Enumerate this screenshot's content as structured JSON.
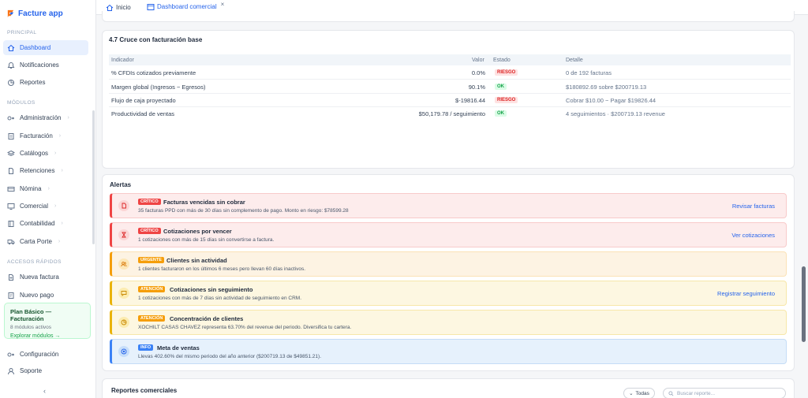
{
  "app": {
    "name": "Facture app"
  },
  "sidebar": {
    "sections": {
      "principal": "PRINCIPAL",
      "modulos": "MÓDULOS",
      "accesos": "ACCESOS RÁPIDOS"
    },
    "items": [
      {
        "label": "Dashboard",
        "icon": "home-icon"
      },
      {
        "label": "Notificaciones",
        "icon": "bell-icon"
      },
      {
        "label": "Reportes",
        "icon": "chart-icon"
      },
      {
        "label": "Administración",
        "icon": "gears-icon"
      },
      {
        "label": "Facturación",
        "icon": "receipt-icon"
      },
      {
        "label": "Catálogos",
        "icon": "layers-icon"
      },
      {
        "label": "Retenciones",
        "icon": "document-icon"
      },
      {
        "label": "Nómina",
        "icon": "card-icon"
      },
      {
        "label": "Comercial",
        "icon": "monitor-icon"
      },
      {
        "label": "Contabilidad",
        "icon": "book-icon"
      },
      {
        "label": "Carta Porte",
        "icon": "truck-icon"
      },
      {
        "label": "Nueva factura",
        "icon": "file-plus-icon"
      },
      {
        "label": "Nuevo pago",
        "icon": "payment-icon"
      },
      {
        "label": "Configuración",
        "icon": "settings-icon"
      },
      {
        "label": "Soporte",
        "icon": "support-icon"
      }
    ],
    "plan": {
      "title": "Plan Básico — Facturación",
      "subtitle": "8 módulos activos",
      "link": "Explorar módulos →"
    },
    "collapse": "‹"
  },
  "tabs": [
    {
      "label": "Inicio"
    },
    {
      "label": "Dashboard comercial",
      "close": "×"
    }
  ],
  "cruce": {
    "title": "4.7 Cruce con facturación base",
    "headers": {
      "indicador": "Indicador",
      "valor": "Valor",
      "estado": "Estado",
      "detalle": "Detalle"
    },
    "rows": [
      {
        "indicador": "% CFDIs cotizados previamente",
        "valor": "0.0%",
        "estado": "RIESGO",
        "detalle": "0 de 192 facturas"
      },
      {
        "indicador": "Margen global (Ingresos − Egresos)",
        "valor": "90.1%",
        "estado": "OK",
        "detalle": "$180892.69 sobre $200719.13"
      },
      {
        "indicador": "Flujo de caja proyectado",
        "valor": "$-19816.44",
        "estado": "RIESGO",
        "detalle": "Cobrar $10.00 − Pagar $19826.44"
      },
      {
        "indicador": "Productividad de ventas",
        "valor": "$50,179.78 / seguimiento",
        "estado": "OK",
        "detalle": "4 seguimientos · $200719.13 revenue"
      }
    ]
  },
  "alertas": {
    "title": "Alertas",
    "items": [
      {
        "tag": "CRÍTICO",
        "title": "Facturas vencidas sin cobrar",
        "desc": "35 facturas PPD con más de 30 días sin complemento de pago. Monto en riesgo: $78599.28",
        "action": "Revisar facturas",
        "icon": "document-icon"
      },
      {
        "tag": "CRÍTICO",
        "title": "Cotizaciones por vencer",
        "desc": "1 cotizaciones con más de 15 días sin convertirse a factura.",
        "action": "Ver cotizaciones",
        "icon": "hourglass-icon"
      },
      {
        "tag": "URGENTE",
        "title": "Clientes sin actividad",
        "desc": "1 clientes facturaron en los últimos 6 meses pero llevan 60 días inactivos.",
        "action": "",
        "icon": "users-icon"
      },
      {
        "tag": "ATENCIÓN",
        "title": "Cotizaciones sin seguimiento",
        "desc": "1 cotizaciones con más de 7 días sin actividad de seguimiento en CRM.",
        "action": "Registrar seguimiento",
        "icon": "chat-icon"
      },
      {
        "tag": "ATENCIÓN",
        "title": "Concentración de clientes",
        "desc": "XOCHILT CASAS CHAVEZ representa 63.70% del revenue del periodo. Diversifica tu cartera.",
        "action": "",
        "icon": "pie-icon"
      },
      {
        "tag": "INFO",
        "title": "Meta de ventas",
        "desc": "Llevas 402.60% del mismo periodo del año anterior ($200719.13 de $49851.21).",
        "action": "",
        "icon": "target-icon"
      }
    ]
  },
  "reportes": {
    "title": "Reportes comerciales",
    "filter": "Todas",
    "search_placeholder": "Buscar reporte..."
  },
  "colors": {
    "brand": "#2563eb",
    "critical": "#ef4444",
    "urgent": "#f59e0b",
    "info": "#3b82f6",
    "ok": "#16a34a"
  }
}
